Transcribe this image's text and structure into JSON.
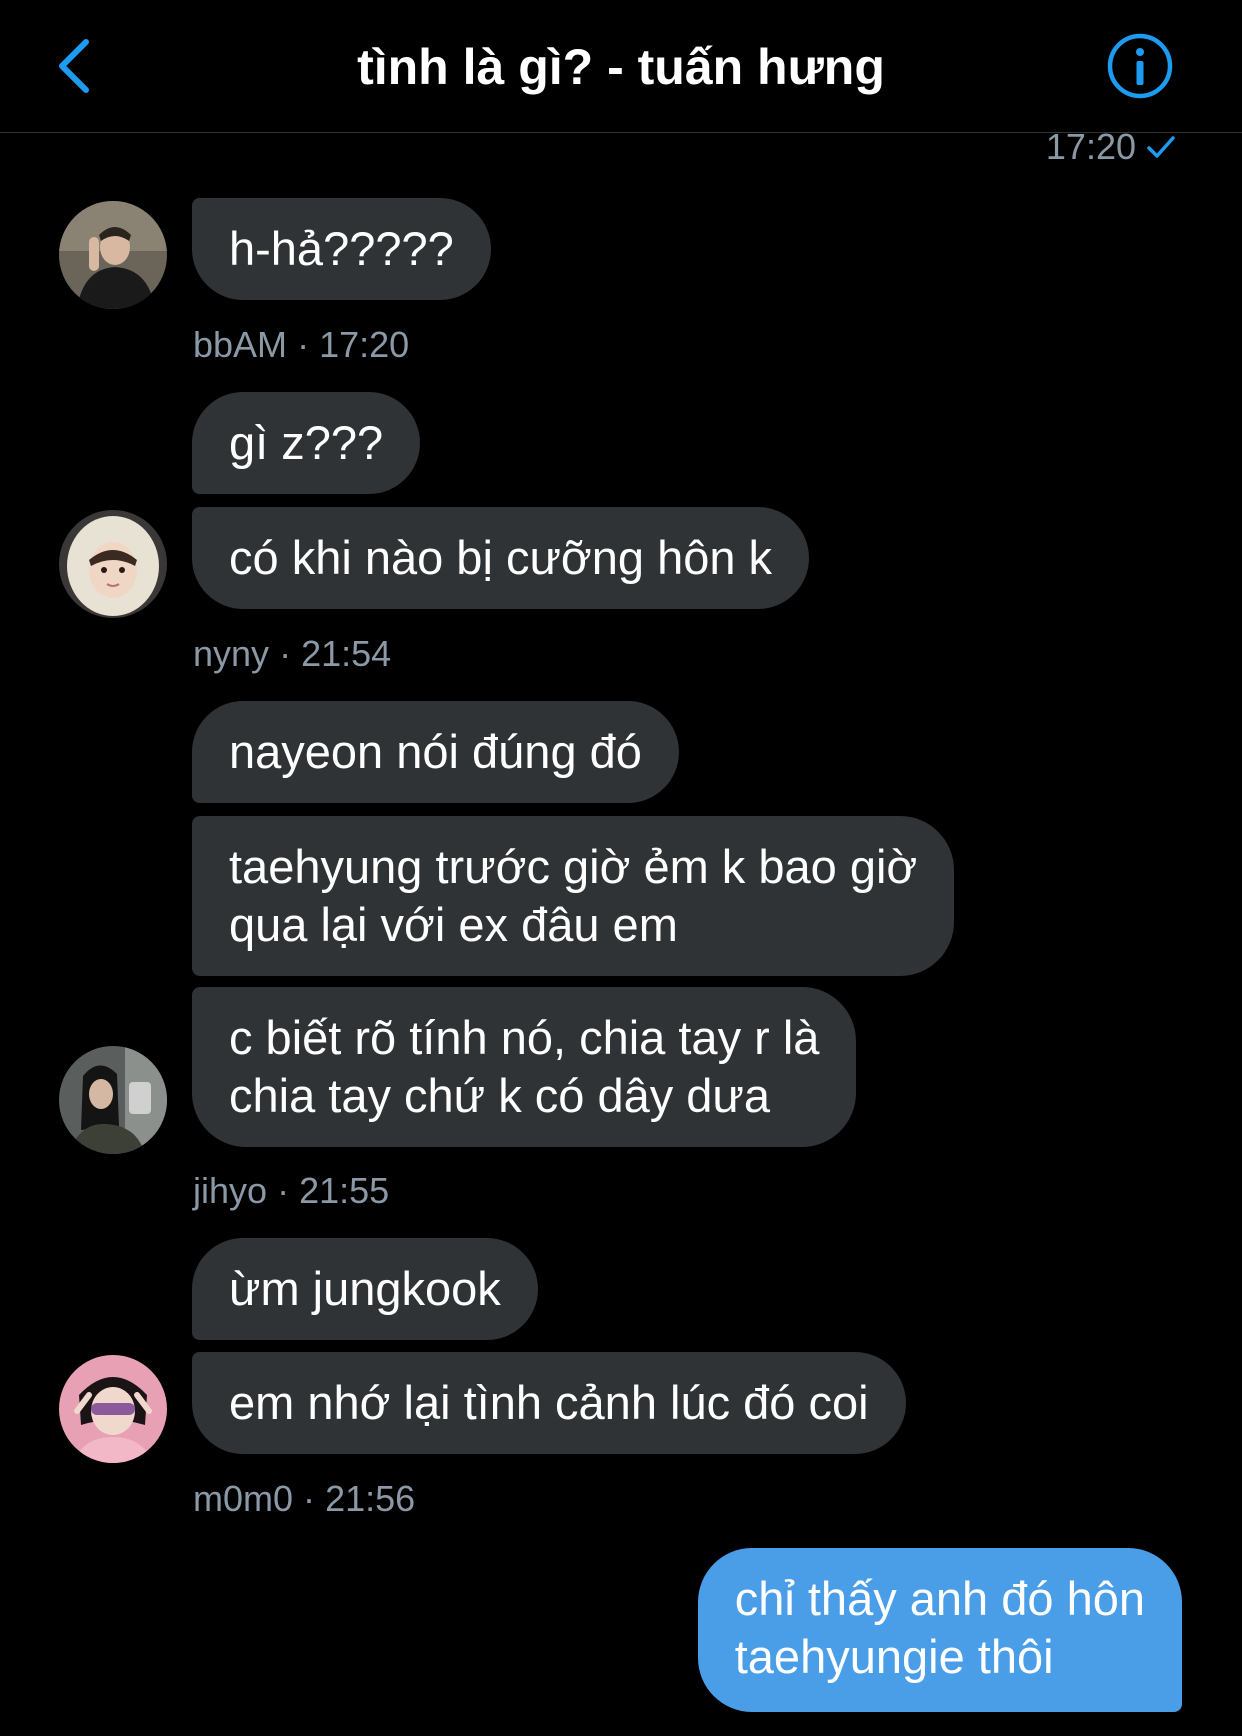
{
  "header": {
    "title": "tình là gì? - tuấn hưng"
  },
  "read_receipt": {
    "time": "17:20"
  },
  "messages": [
    {
      "sender": "bbAM",
      "time": "17:20",
      "bubbles": [
        "h-hả?????"
      ]
    },
    {
      "sender": "nyny",
      "time": "21:54",
      "bubbles": [
        "gì z???",
        "có khi nào bị cưỡng hôn k"
      ]
    },
    {
      "sender": "jihyo",
      "time": "21:55",
      "bubbles": [
        "nayeon nói đúng đó",
        "taehyung trước giờ ẻm k bao giờ\nqua lại với ex đâu em",
        "c biết rõ tính nó, chia tay r là\nchia tay chứ k có dây dưa"
      ]
    },
    {
      "sender": "m0m0",
      "time": "21:56",
      "bubbles": [
        "ừm jungkook",
        "em nhớ lại tình cảnh lúc đó coi"
      ]
    }
  ],
  "outgoing": {
    "text": "chỉ thấy anh đó hôn\ntaehyungie thôi"
  },
  "meta_separator": "·",
  "colors": {
    "background": "#000000",
    "incoming_bubble": "#2f3336",
    "outgoing_bubble": "#4a9ee8",
    "accent": "#1d9bf0",
    "secondary_text": "#8b98a5"
  },
  "icons": {
    "back": "chevron-left-icon",
    "info": "info-icon",
    "receipt": "checkmark-icon"
  }
}
